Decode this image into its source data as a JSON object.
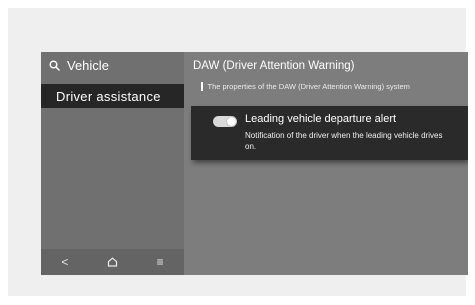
{
  "sidebar": {
    "search_label": "Vehicle",
    "active_item": "Driver assistance",
    "bottom_bar": {
      "back_glyph": "<",
      "home_icon": "home-icon",
      "menu_glyph": "≡"
    }
  },
  "panel": {
    "title": "DAW (Driver Attention Warning)",
    "subtitle": "The properties of the DAW (Driver Attention Warning) system",
    "setting": {
      "title": "Leading vehicle departure alert",
      "description": "Notification of the driver when the leading vehicle drives on.",
      "enabled": true
    }
  },
  "colors": {
    "screen_bg": "#7d7d7d",
    "sidebar_bg": "#707070",
    "active_item_bg": "#262626",
    "card_bg": "#2a2a2a",
    "toggle_on": "#d9d9d9"
  }
}
